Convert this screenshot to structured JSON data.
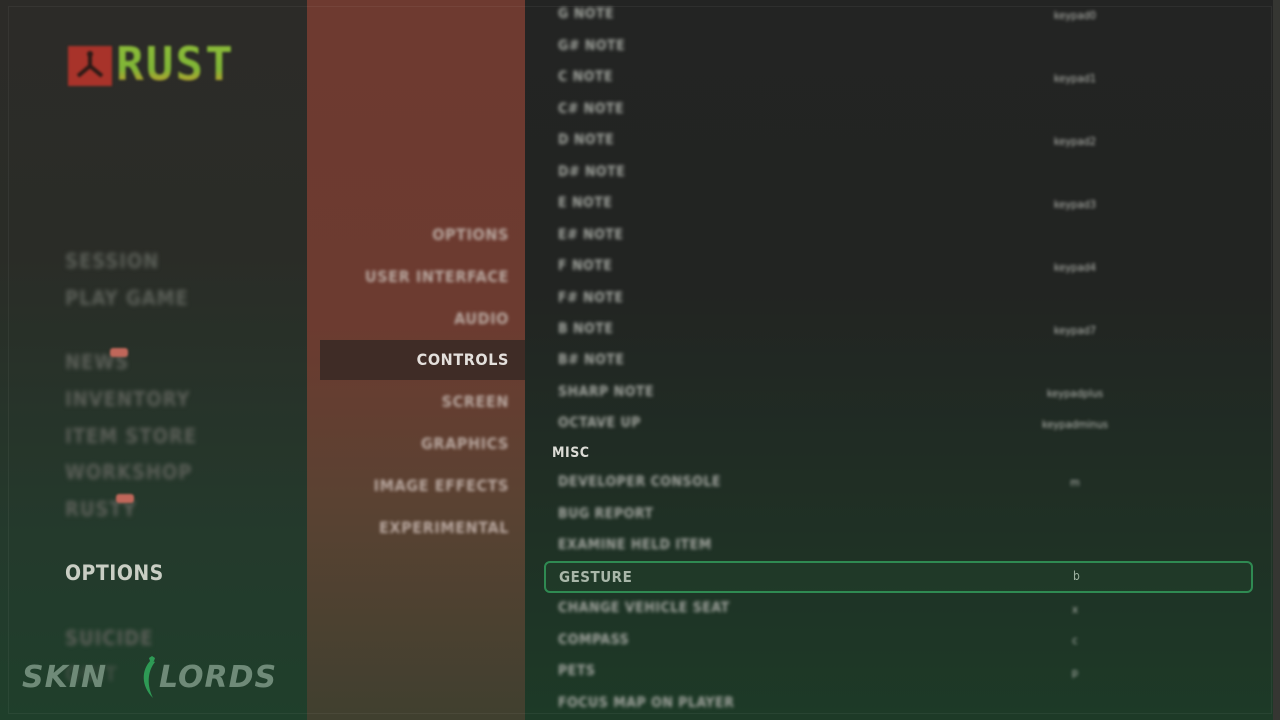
{
  "app": {
    "title": "RUST",
    "logo_text": "RUST"
  },
  "main_menu": {
    "items": [
      {
        "label": "SESSION",
        "active": false
      },
      {
        "label": "PLAY GAME",
        "active": false
      },
      {
        "label": "NEWS",
        "active": false,
        "badge": true
      },
      {
        "label": "INVENTORY",
        "active": false
      },
      {
        "label": "ITEM STORE",
        "active": false
      },
      {
        "label": "WORKSHOP",
        "active": false
      },
      {
        "label": "RUSTY",
        "active": false,
        "badge": true
      },
      {
        "label": "OPTIONS",
        "active": true
      },
      {
        "label": "SUICIDE",
        "active": false
      },
      {
        "label": "QUIT",
        "active": false
      }
    ]
  },
  "options_menu": {
    "items": [
      {
        "label": "OPTIONS"
      },
      {
        "label": "USER INTERFACE"
      },
      {
        "label": "AUDIO"
      },
      {
        "label": "CONTROLS",
        "active": true
      },
      {
        "label": "SCREEN"
      },
      {
        "label": "GRAPHICS"
      },
      {
        "label": "IMAGE EFFECTS"
      },
      {
        "label": "EXPERIMENTAL"
      }
    ]
  },
  "controls": {
    "instrument_rows": [
      {
        "action": "G NOTE",
        "key": "keypad0"
      },
      {
        "action": "G# NOTE",
        "key": ""
      },
      {
        "action": "C NOTE",
        "key": "keypad1"
      },
      {
        "action": "C# NOTE",
        "key": ""
      },
      {
        "action": "D NOTE",
        "key": "keypad2"
      },
      {
        "action": "D# NOTE",
        "key": ""
      },
      {
        "action": "E NOTE",
        "key": "keypad3"
      },
      {
        "action": "E# NOTE",
        "key": ""
      },
      {
        "action": "F NOTE",
        "key": "keypad4"
      },
      {
        "action": "F# NOTE",
        "key": ""
      },
      {
        "action": "B NOTE",
        "key": "keypad7"
      },
      {
        "action": "B# NOTE",
        "key": ""
      },
      {
        "action": "SHARP NOTE",
        "key": "keypadplus"
      },
      {
        "action": "OCTAVE UP",
        "key": "keypadminus"
      }
    ],
    "misc_section": "MISC",
    "misc_rows": [
      {
        "action": "DEVELOPER CONSOLE",
        "key": "m"
      },
      {
        "action": "BUG REPORT",
        "key": ""
      },
      {
        "action": "EXAMINE HELD ITEM",
        "key": ""
      },
      {
        "action": "GESTURE",
        "key": "b",
        "selected": true
      },
      {
        "action": "CHANGE VEHICLE SEAT",
        "key": "x"
      },
      {
        "action": "COMPASS",
        "key": "c"
      },
      {
        "action": "PETS",
        "key": "p"
      },
      {
        "action": "FOCUS MAP ON PLAYER",
        "key": ""
      }
    ]
  },
  "watermark": {
    "left": "SKIN",
    "right": "LORDS"
  },
  "colors": {
    "accent_green": "#2f8a52",
    "submenu_red": "#6e3a30",
    "logo_red": "#a8332a",
    "logo_green": "#8fbe3a"
  }
}
